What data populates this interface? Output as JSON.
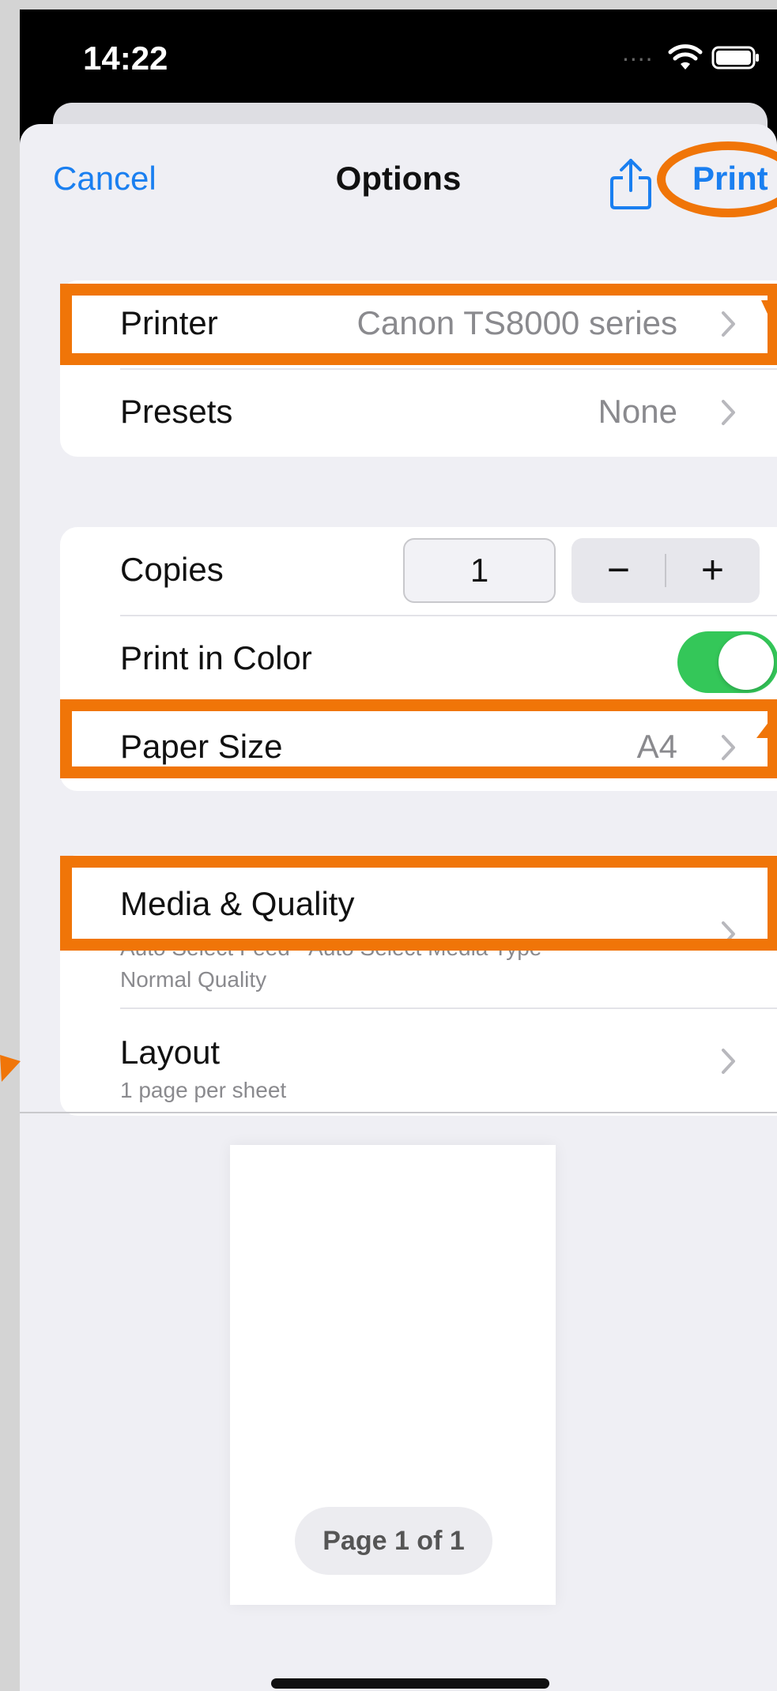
{
  "status_bar": {
    "time": "14:22",
    "signal": "....",
    "icons": [
      "wifi-icon",
      "battery-icon"
    ]
  },
  "nav": {
    "cancel_label": "Cancel",
    "title": "Options",
    "share_icon": "share-icon",
    "print_label": "Print"
  },
  "printer_group": {
    "printer": {
      "label": "Printer",
      "value": "Canon TS8000 series"
    },
    "presets": {
      "label": "Presets",
      "value": "None"
    }
  },
  "settings_group": {
    "copies": {
      "label": "Copies",
      "value": "1",
      "decrement": "−",
      "increment": "+"
    },
    "print_in_color": {
      "label": "Print in Color",
      "enabled": true
    },
    "paper_size": {
      "label": "Paper Size",
      "value": "A4"
    }
  },
  "options_group": {
    "media_quality": {
      "label": "Media & Quality",
      "detail_line1": "Auto Select Feed · Auto Select Media Type",
      "detail_line2": "Normal Quality"
    },
    "layout": {
      "label": "Layout",
      "detail": "1 page per sheet"
    }
  },
  "preview": {
    "page_counter": "Page 1 of 1"
  },
  "colors": {
    "accent": "#1a7ff0",
    "annotation": "#f07508",
    "toggle_on": "#34c759",
    "background": "#efeff4"
  }
}
